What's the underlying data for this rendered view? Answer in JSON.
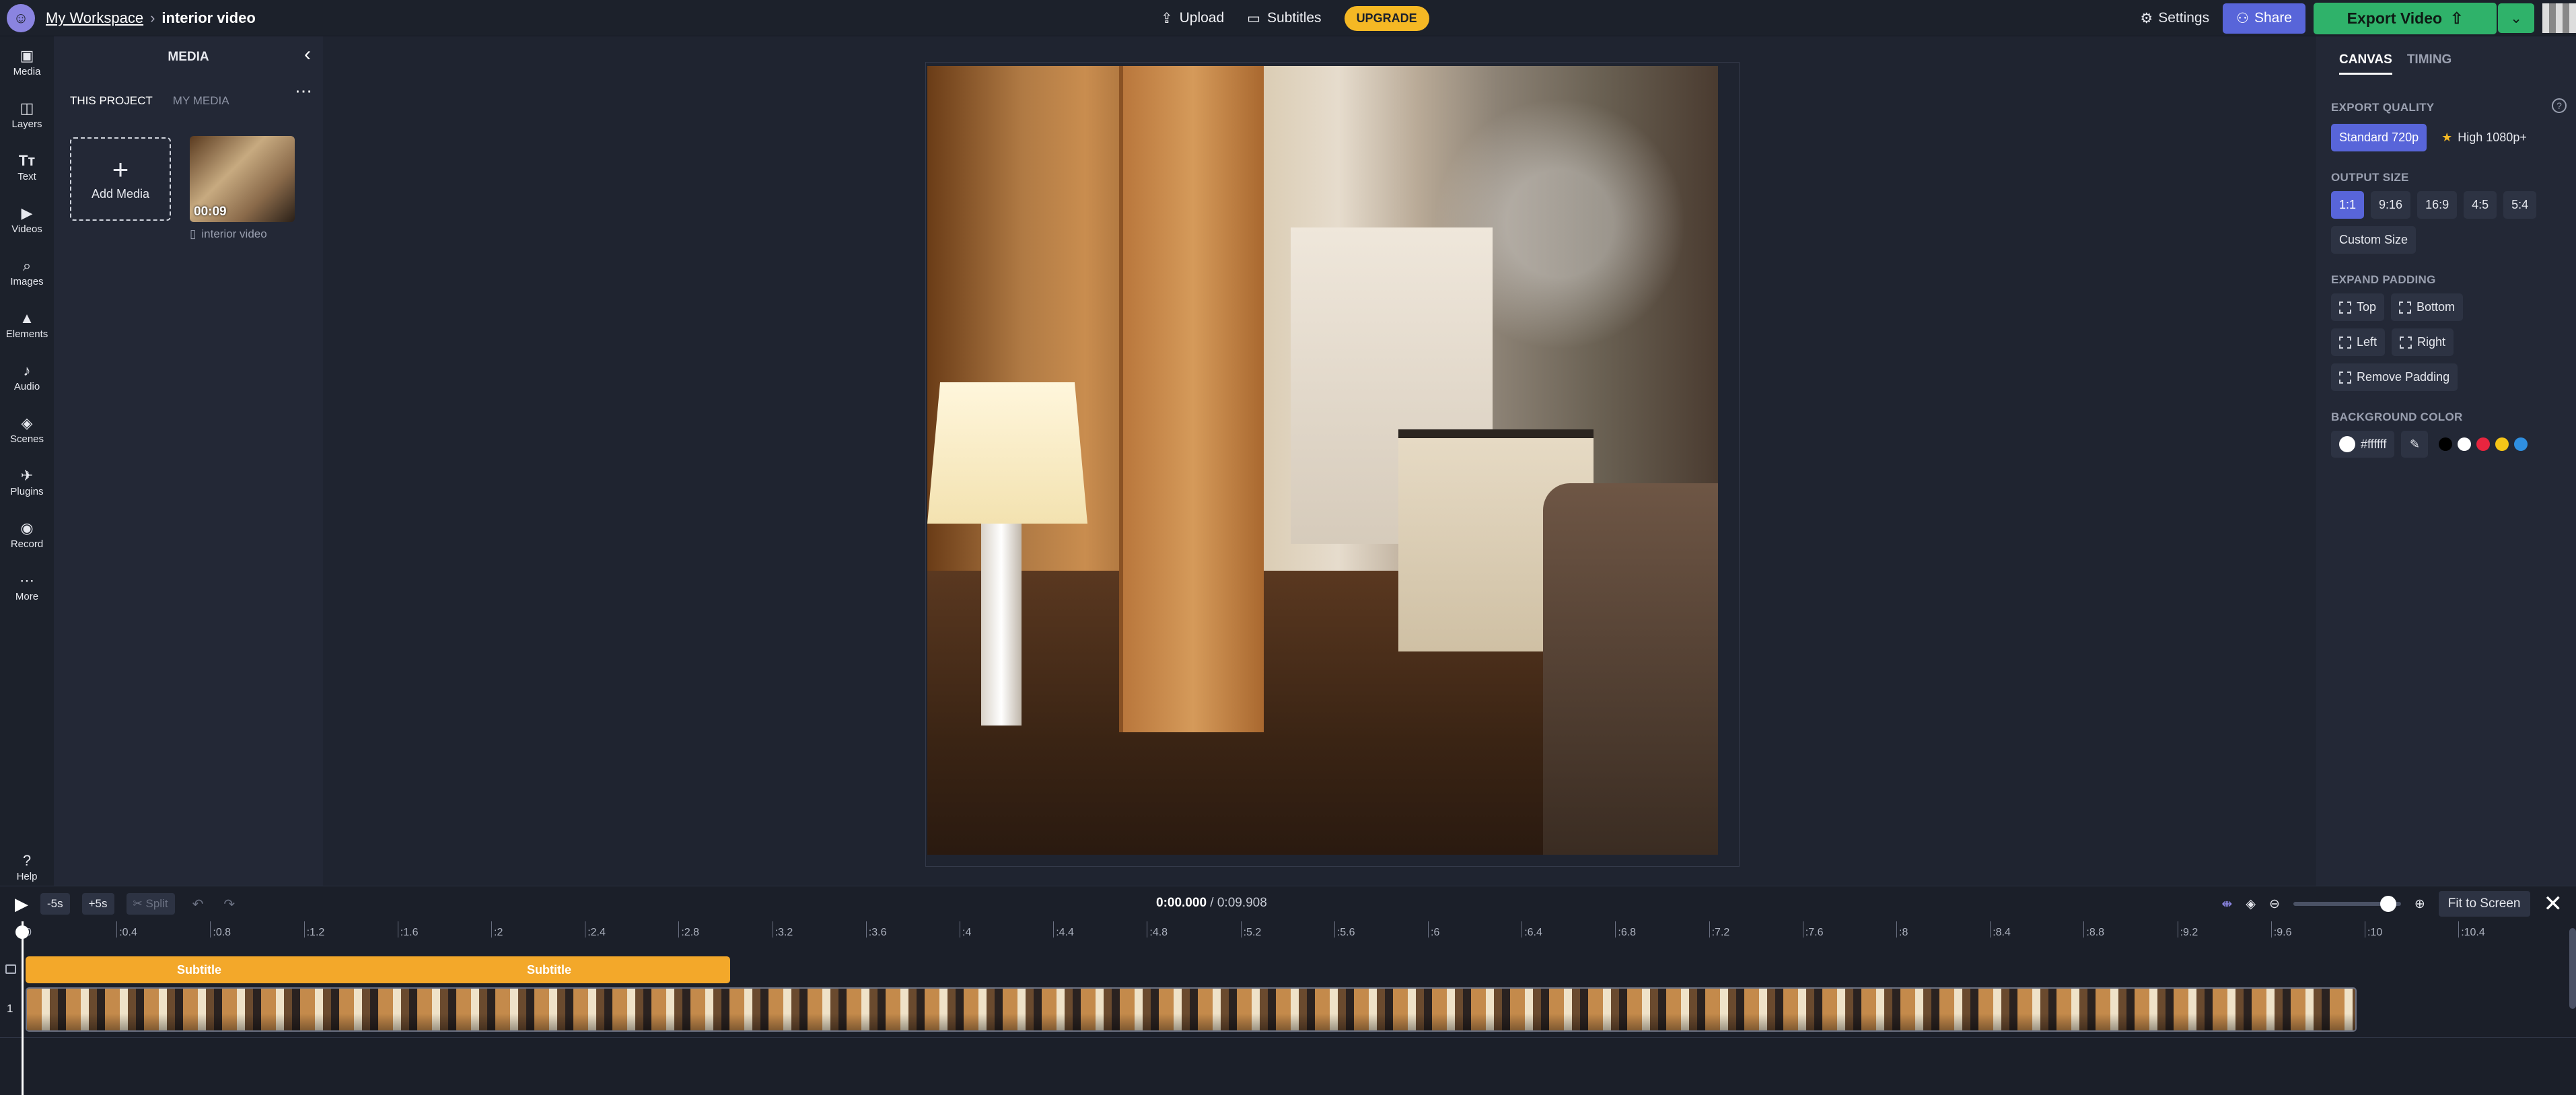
{
  "topbar": {
    "workspace": "My Workspace",
    "separator": "›",
    "project": "interior video",
    "upload": "Upload",
    "subtitles": "Subtitles",
    "upgrade": "UPGRADE",
    "settings": "Settings",
    "share": "Share",
    "export": "Export Video"
  },
  "rail": {
    "items": [
      {
        "label": "Media",
        "icon": "media-icon"
      },
      {
        "label": "Layers",
        "icon": "layers-icon"
      },
      {
        "label": "Text",
        "icon": "text-icon"
      },
      {
        "label": "Videos",
        "icon": "videos-icon"
      },
      {
        "label": "Images",
        "icon": "images-icon"
      },
      {
        "label": "Elements",
        "icon": "elements-icon"
      },
      {
        "label": "Audio",
        "icon": "audio-icon"
      },
      {
        "label": "Scenes",
        "icon": "scenes-icon"
      },
      {
        "label": "Plugins",
        "icon": "plugins-icon"
      },
      {
        "label": "Record",
        "icon": "record-icon"
      },
      {
        "label": "More",
        "icon": "more-icon"
      }
    ],
    "help": "Help"
  },
  "media": {
    "title": "MEDIA",
    "tabs": [
      "THIS PROJECT",
      "MY MEDIA"
    ],
    "add_media": "Add Media",
    "clip_duration": "00:09",
    "clip_name": "interior video"
  },
  "right_panel": {
    "tabs": [
      "CANVAS",
      "TIMING"
    ],
    "export_quality_label": "EXPORT QUALITY",
    "quality_standard": "Standard 720p",
    "quality_high": "High 1080p+",
    "output_size_label": "OUTPUT SIZE",
    "sizes": [
      "1:1",
      "9:16",
      "16:9",
      "4:5",
      "5:4"
    ],
    "selected_size": "1:1",
    "custom_size": "Custom Size",
    "expand_padding_label": "EXPAND PADDING",
    "padding": {
      "top": "Top",
      "bottom": "Bottom",
      "left": "Left",
      "right": "Right",
      "remove": "Remove Padding"
    },
    "background_color_label": "BACKGROUND COLOR",
    "background_color_value": "#ffffff",
    "swatches": [
      "#000000",
      "#ffffff",
      "#e8253f",
      "#f5c518",
      "#2f8fe0"
    ]
  },
  "timeline": {
    "minus5": "-5s",
    "plus5": "+5s",
    "split": "Split",
    "current_time": "0:00.000",
    "total_time": "/ 0:09.908",
    "fit_to_screen": "Fit to Screen",
    "zoom_level": 0.88,
    "ticks": [
      "0",
      ":0.4",
      ":0.8",
      ":1.2",
      ":1.6",
      ":2",
      ":2.4",
      ":2.8",
      ":3.2",
      ":3.6",
      ":4",
      ":4.4",
      ":4.8",
      ":5.2",
      ":5.6",
      ":6",
      ":6.4",
      ":6.8",
      ":7.2",
      ":7.6",
      ":8",
      ":8.4",
      ":8.8",
      ":9.2",
      ":9.6",
      ":10",
      ":10.4"
    ],
    "subtitle_labels": [
      "Subtitle",
      "Subtitle"
    ],
    "track_number": "1"
  },
  "colors": {
    "accent": "#5865d9",
    "export_green": "#2fb26a",
    "upgrade_yellow": "#f5b824",
    "subtitle_orange": "#f3a82a"
  }
}
